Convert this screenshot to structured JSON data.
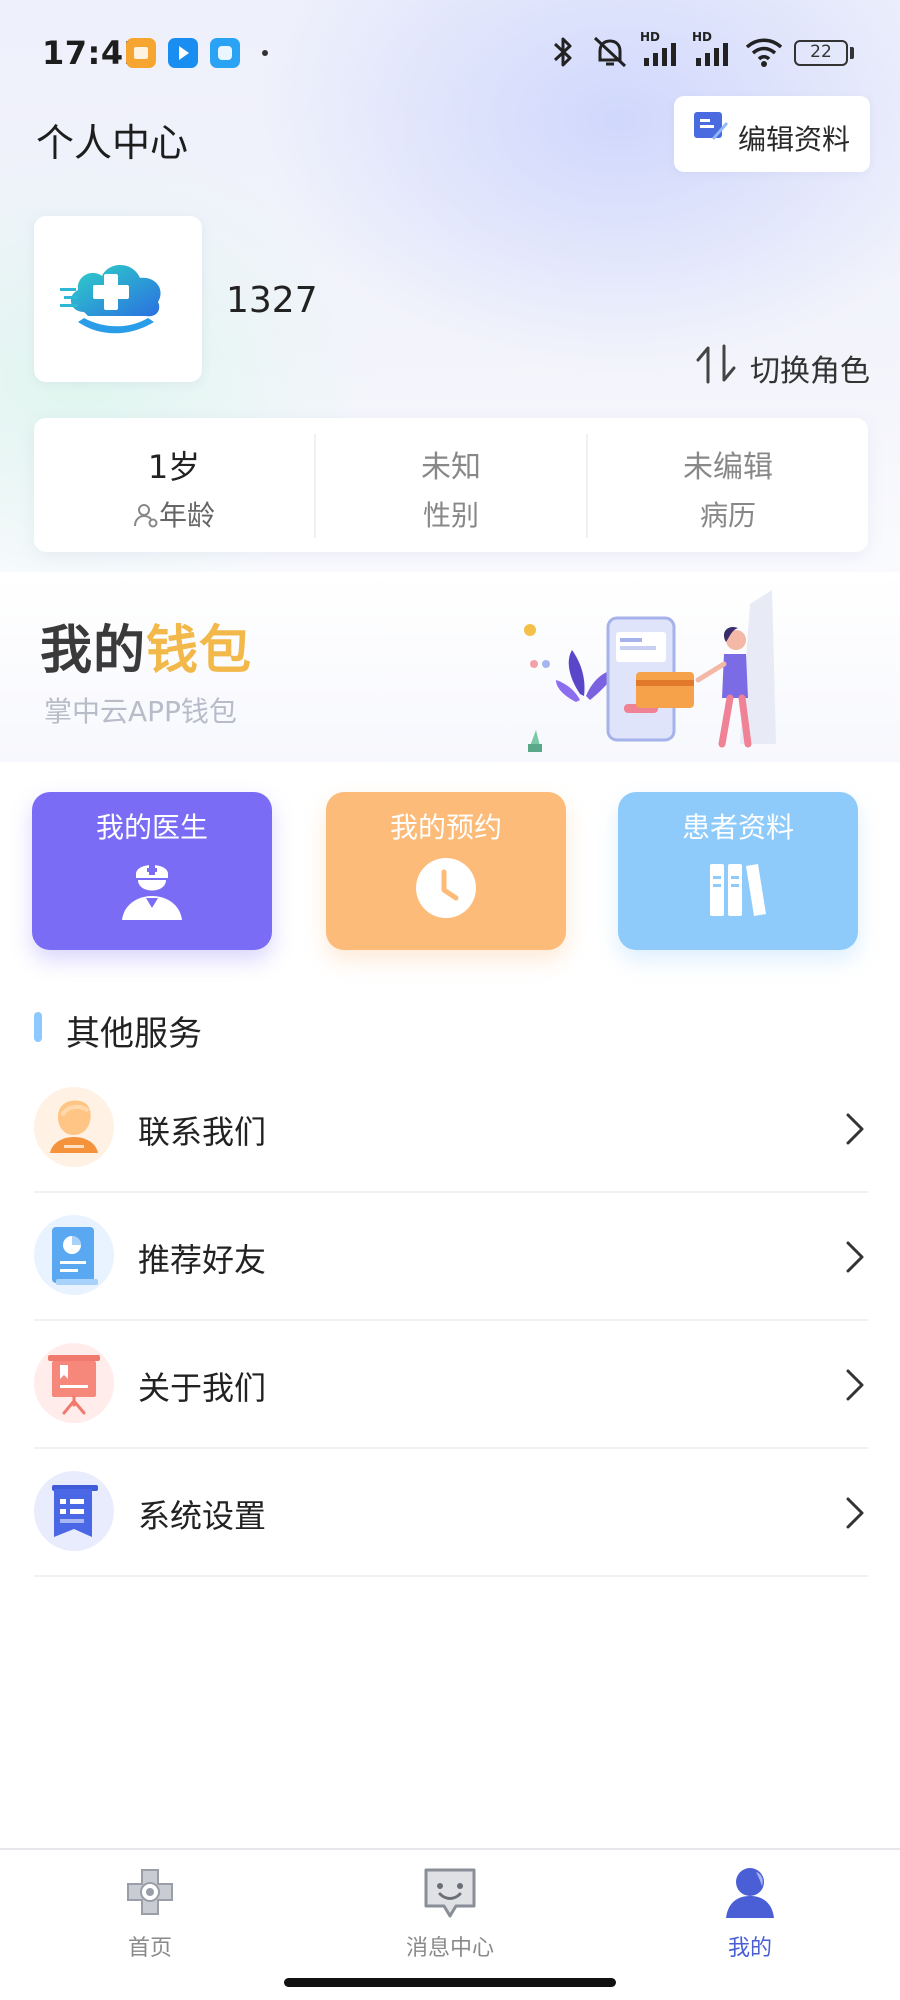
{
  "status_bar": {
    "time": "17:42",
    "battery": "22",
    "notif_icons": [
      {
        "name": "orange-app-notification-icon",
        "color": "#f6a531"
      },
      {
        "name": "blue-app-notification-icon",
        "color": "#1a8df0"
      },
      {
        "name": "cyan-app-notification-icon",
        "color": "#2aa3f5"
      }
    ],
    "hd1": "HD",
    "hd2": "HD"
  },
  "header": {
    "title": "个人中心",
    "edit_label": "编辑资料"
  },
  "profile": {
    "name": "1327",
    "switch_role_label": "切换角色"
  },
  "stats": [
    {
      "value": "1岁",
      "label": "年龄"
    },
    {
      "value": "未知",
      "label": "性别"
    },
    {
      "value": "未编辑",
      "label": "病历"
    }
  ],
  "wallet": {
    "title_part1": "我的",
    "title_part2": "钱包",
    "subtitle": "掌中云APP钱包"
  },
  "quick_actions": [
    {
      "label": "我的医生",
      "color": "#7b6cf6",
      "icon": "doctor-icon"
    },
    {
      "label": "我的预约",
      "color": "#fdbb7a",
      "icon": "clock-icon"
    },
    {
      "label": "患者资料",
      "color": "#8ecbfb",
      "icon": "books-icon"
    }
  ],
  "other_services": {
    "title": "其他服务",
    "items": [
      {
        "label": "联系我们",
        "icon": "contact-person-icon"
      },
      {
        "label": "推荐好友",
        "icon": "recommend-doc-icon"
      },
      {
        "label": "关于我们",
        "icon": "presentation-board-icon"
      },
      {
        "label": "系统设置",
        "icon": "settings-doc-icon"
      }
    ]
  },
  "bottom_nav": {
    "items": [
      {
        "label": "首页",
        "icon": "home-cross-icon"
      },
      {
        "label": "消息中心",
        "icon": "message-icon"
      },
      {
        "label": "我的",
        "icon": "profile-icon"
      }
    ],
    "active_index": 2,
    "active_color": "#4a5fd6",
    "inactive_color": "#8a8a8a"
  }
}
